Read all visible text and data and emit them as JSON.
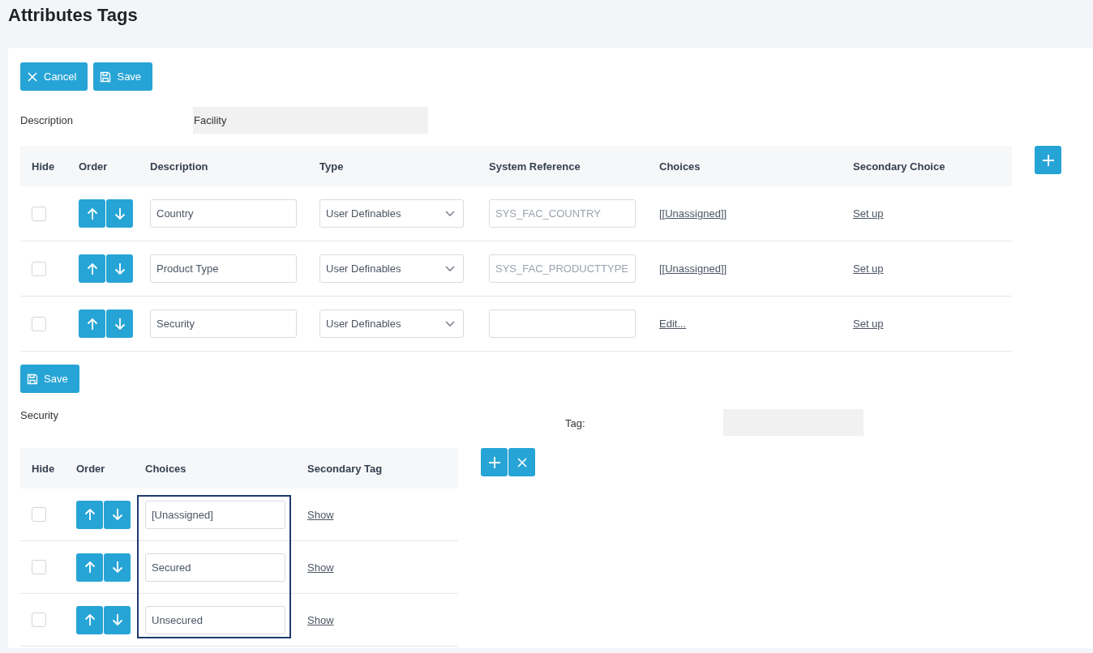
{
  "page_title": "Attributes Tags",
  "toolbar": [
    {
      "kind": "cancel",
      "label": "Cancel"
    },
    {
      "kind": "save",
      "label": "Save"
    }
  ],
  "description": {
    "label": "Description",
    "value": "Facility"
  },
  "attributes_table": {
    "columns": [
      "Hide",
      "Order",
      "Description",
      "Type",
      "System Reference",
      "Choices",
      "Secondary Choice"
    ],
    "rows": [
      {
        "hidden": false,
        "description": "Country",
        "type": "User Definables",
        "system_reference_placeholder": "SYS_FAC_COUNTRY",
        "choices": "[[Unassigned]]",
        "secondary_choice": "Set up"
      },
      {
        "hidden": false,
        "description": "Product Type",
        "type": "User Definables",
        "system_reference_placeholder": "SYS_FAC_PRODUCTTYPE",
        "choices": "[[Unassigned]]",
        "secondary_choice": "Set up"
      },
      {
        "hidden": false,
        "description": "Security",
        "type": "User Definables",
        "choices": "Edit...",
        "secondary_choice": "Set up"
      }
    ]
  },
  "save_button": {
    "label": "Save"
  },
  "choices_section": {
    "title": "Security",
    "tag_label": "Tag:",
    "columns": [
      "Hide",
      "Order",
      "Choices",
      "Secondary Tag"
    ],
    "rows": [
      {
        "hidden": false,
        "choice": "[Unassigned]",
        "secondary_tag": "Show"
      },
      {
        "hidden": false,
        "choice": "Secured",
        "secondary_tag": "Show"
      },
      {
        "hidden": false,
        "choice": "Unsecured",
        "secondary_tag": "Show"
      }
    ]
  }
}
